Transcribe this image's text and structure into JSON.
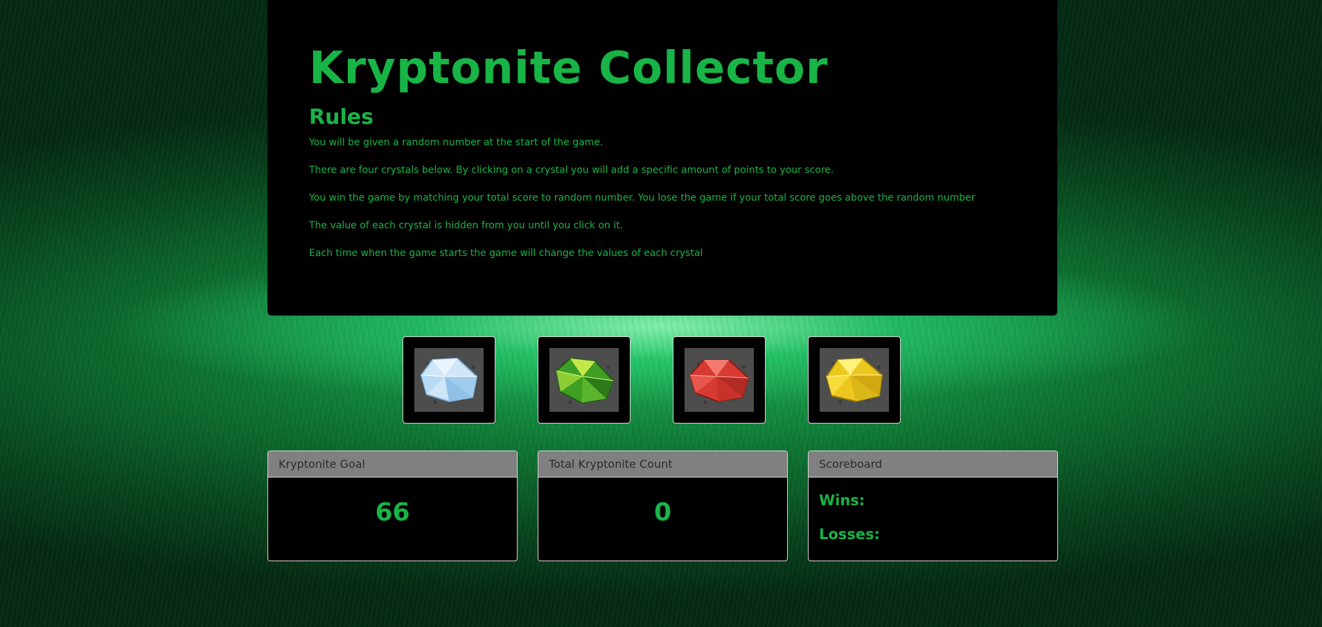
{
  "game": {
    "title": "Kryptonite Collector",
    "rules_heading": "Rules",
    "rules": [
      "You will be given a random number at the start of the game.",
      "There are four crystals below. By clicking on a crystal you will add a specific amount of points to your score.",
      "You win the game by matching your total score to random number. You lose the game if your total score goes above the random number",
      "The value of each crystal is hidden from you until you click on it.",
      "Each time when the game starts the game will change the values of each crystal"
    ]
  },
  "crystals": [
    {
      "name": "blue-crystal",
      "color": "#bfe0f7"
    },
    {
      "name": "green-crystal",
      "color": "#4fb82e"
    },
    {
      "name": "red-crystal",
      "color": "#e0453c"
    },
    {
      "name": "yellow-crystal",
      "color": "#f2d32a"
    }
  ],
  "goal": {
    "header": "Kryptonite Goal",
    "value": "66"
  },
  "total": {
    "header": "Total Kryptonite Count",
    "value": "0"
  },
  "scoreboard": {
    "header": "Scoreboard",
    "wins_label": "Wins:",
    "wins_value": "",
    "losses_label": "Losses:",
    "losses_value": ""
  },
  "colors": {
    "accent": "#18b446",
    "panel": "#000000",
    "card_header": "#808080"
  }
}
